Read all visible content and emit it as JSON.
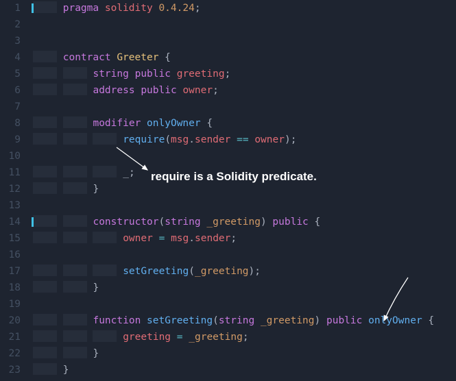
{
  "annotation1": "require is a Solidity predicate.",
  "code": {
    "l1": {
      "a": "pragma",
      "b": " ",
      "c": "solidity",
      "d": " ",
      "e": "0.4.24",
      "f": ";"
    },
    "l4": {
      "a": "contract",
      "b": " ",
      "c": "Greeter",
      "d": " {"
    },
    "l5": {
      "a": "string",
      "b": " ",
      "c": "public",
      "d": " ",
      "e": "greeting",
      "f": ";"
    },
    "l6": {
      "a": "address",
      "b": " ",
      "c": "public",
      "d": " ",
      "e": "owner",
      "f": ";"
    },
    "l8": {
      "a": "modifier",
      "b": " ",
      "c": "onlyOwner",
      "d": " {"
    },
    "l9": {
      "a": "require",
      "b": "(",
      "c": "msg",
      "d": ".",
      "e": "sender",
      "f": " ",
      "g": "==",
      "h": " ",
      "i": "owner",
      "j": ");"
    },
    "l11": {
      "a": "_",
      "b": ";"
    },
    "l12": {
      "a": "}"
    },
    "l14": {
      "a": "constructor",
      "b": "(",
      "c": "string",
      "d": " ",
      "e": "_greeting",
      "f": ")",
      "g": " ",
      "h": "public",
      "i": " {"
    },
    "l15": {
      "a": "owner",
      "b": " ",
      "c": "=",
      "d": " ",
      "e": "msg",
      "f": ".",
      "g": "sender",
      "h": ";"
    },
    "l17": {
      "a": "setGreeting",
      "b": "(",
      "c": "_greeting",
      "d": ");"
    },
    "l18": {
      "a": "}"
    },
    "l20": {
      "a": "function",
      "b": " ",
      "c": "setGreeting",
      "d": "(",
      "e": "string",
      "f": " ",
      "g": "_greeting",
      "h": ")",
      "i": " ",
      "j": "public",
      "k": " ",
      "l": "onlyOwner",
      "m": " {"
    },
    "l21": {
      "a": "greeting",
      "b": " ",
      "c": "=",
      "d": " ",
      "e": "_greeting",
      "f": ";"
    },
    "l22": {
      "a": "}"
    },
    "l23": {
      "a": "}"
    }
  },
  "lines": [
    "1",
    "2",
    "3",
    "4",
    "5",
    "6",
    "7",
    "8",
    "9",
    "10",
    "11",
    "12",
    "13",
    "14",
    "15",
    "16",
    "17",
    "18",
    "19",
    "20",
    "21",
    "22",
    "23"
  ]
}
